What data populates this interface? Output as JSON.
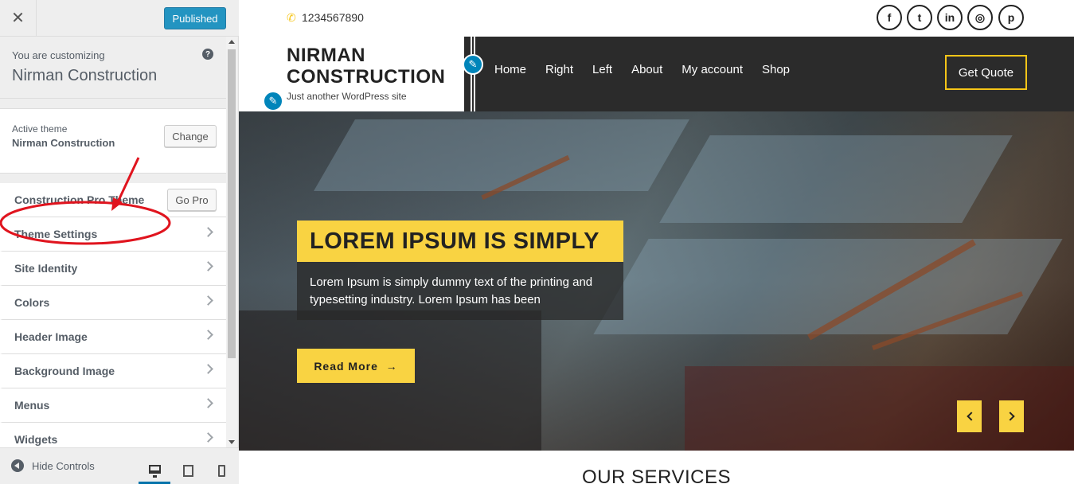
{
  "sidebar": {
    "close_symbol": "✕",
    "publish_label": "Published",
    "customizing_label": "You are customizing",
    "site_name": "Nirman Construction",
    "help_symbol": "?",
    "active_theme_label": "Active theme",
    "active_theme_name": "Nirman Construction",
    "change_label": "Change",
    "pro_section": {
      "label": "Construction Pro Theme",
      "button": "Go Pro"
    },
    "sections": [
      {
        "label": "Theme Settings"
      },
      {
        "label": "Site Identity"
      },
      {
        "label": "Colors"
      },
      {
        "label": "Header Image"
      },
      {
        "label": "Background Image"
      },
      {
        "label": "Menus"
      },
      {
        "label": "Widgets"
      }
    ],
    "footer": {
      "hide_controls_label": "Hide Controls",
      "devices": [
        "desktop-icon",
        "tablet-icon",
        "mobile-icon"
      ],
      "active_device": "desktop"
    }
  },
  "annotation": {
    "color": "#e0141e",
    "target": "Theme Settings"
  },
  "site": {
    "phone": "1234567890",
    "phone_icon": "phone-icon",
    "social": [
      {
        "name": "facebook-icon",
        "glyph": "f"
      },
      {
        "name": "twitter-icon",
        "glyph": "t"
      },
      {
        "name": "linkedin-icon",
        "glyph": "in"
      },
      {
        "name": "instagram-icon",
        "glyph": "◎"
      },
      {
        "name": "pinterest-icon",
        "glyph": "p"
      }
    ],
    "logo_title": "NIRMAN CONSTRUCTION",
    "tagline": "Just another WordPress site",
    "nav": [
      "Home",
      "Right",
      "Left",
      "About",
      "My account",
      "Shop"
    ],
    "quote_button": "Get Quote",
    "hero": {
      "title": "LOREM IPSUM IS SIMPLY",
      "text": "Lorem Ipsum is simply dummy text of the printing and typesetting industry. Lorem Ipsum has been",
      "read_more": "Read More",
      "read_more_arrow": "→"
    },
    "services_title": "OUR SERVICES",
    "colors": {
      "accent": "#f9d342",
      "nav_bg": "#2b2b2b",
      "wp_blue": "#0085ba"
    }
  }
}
